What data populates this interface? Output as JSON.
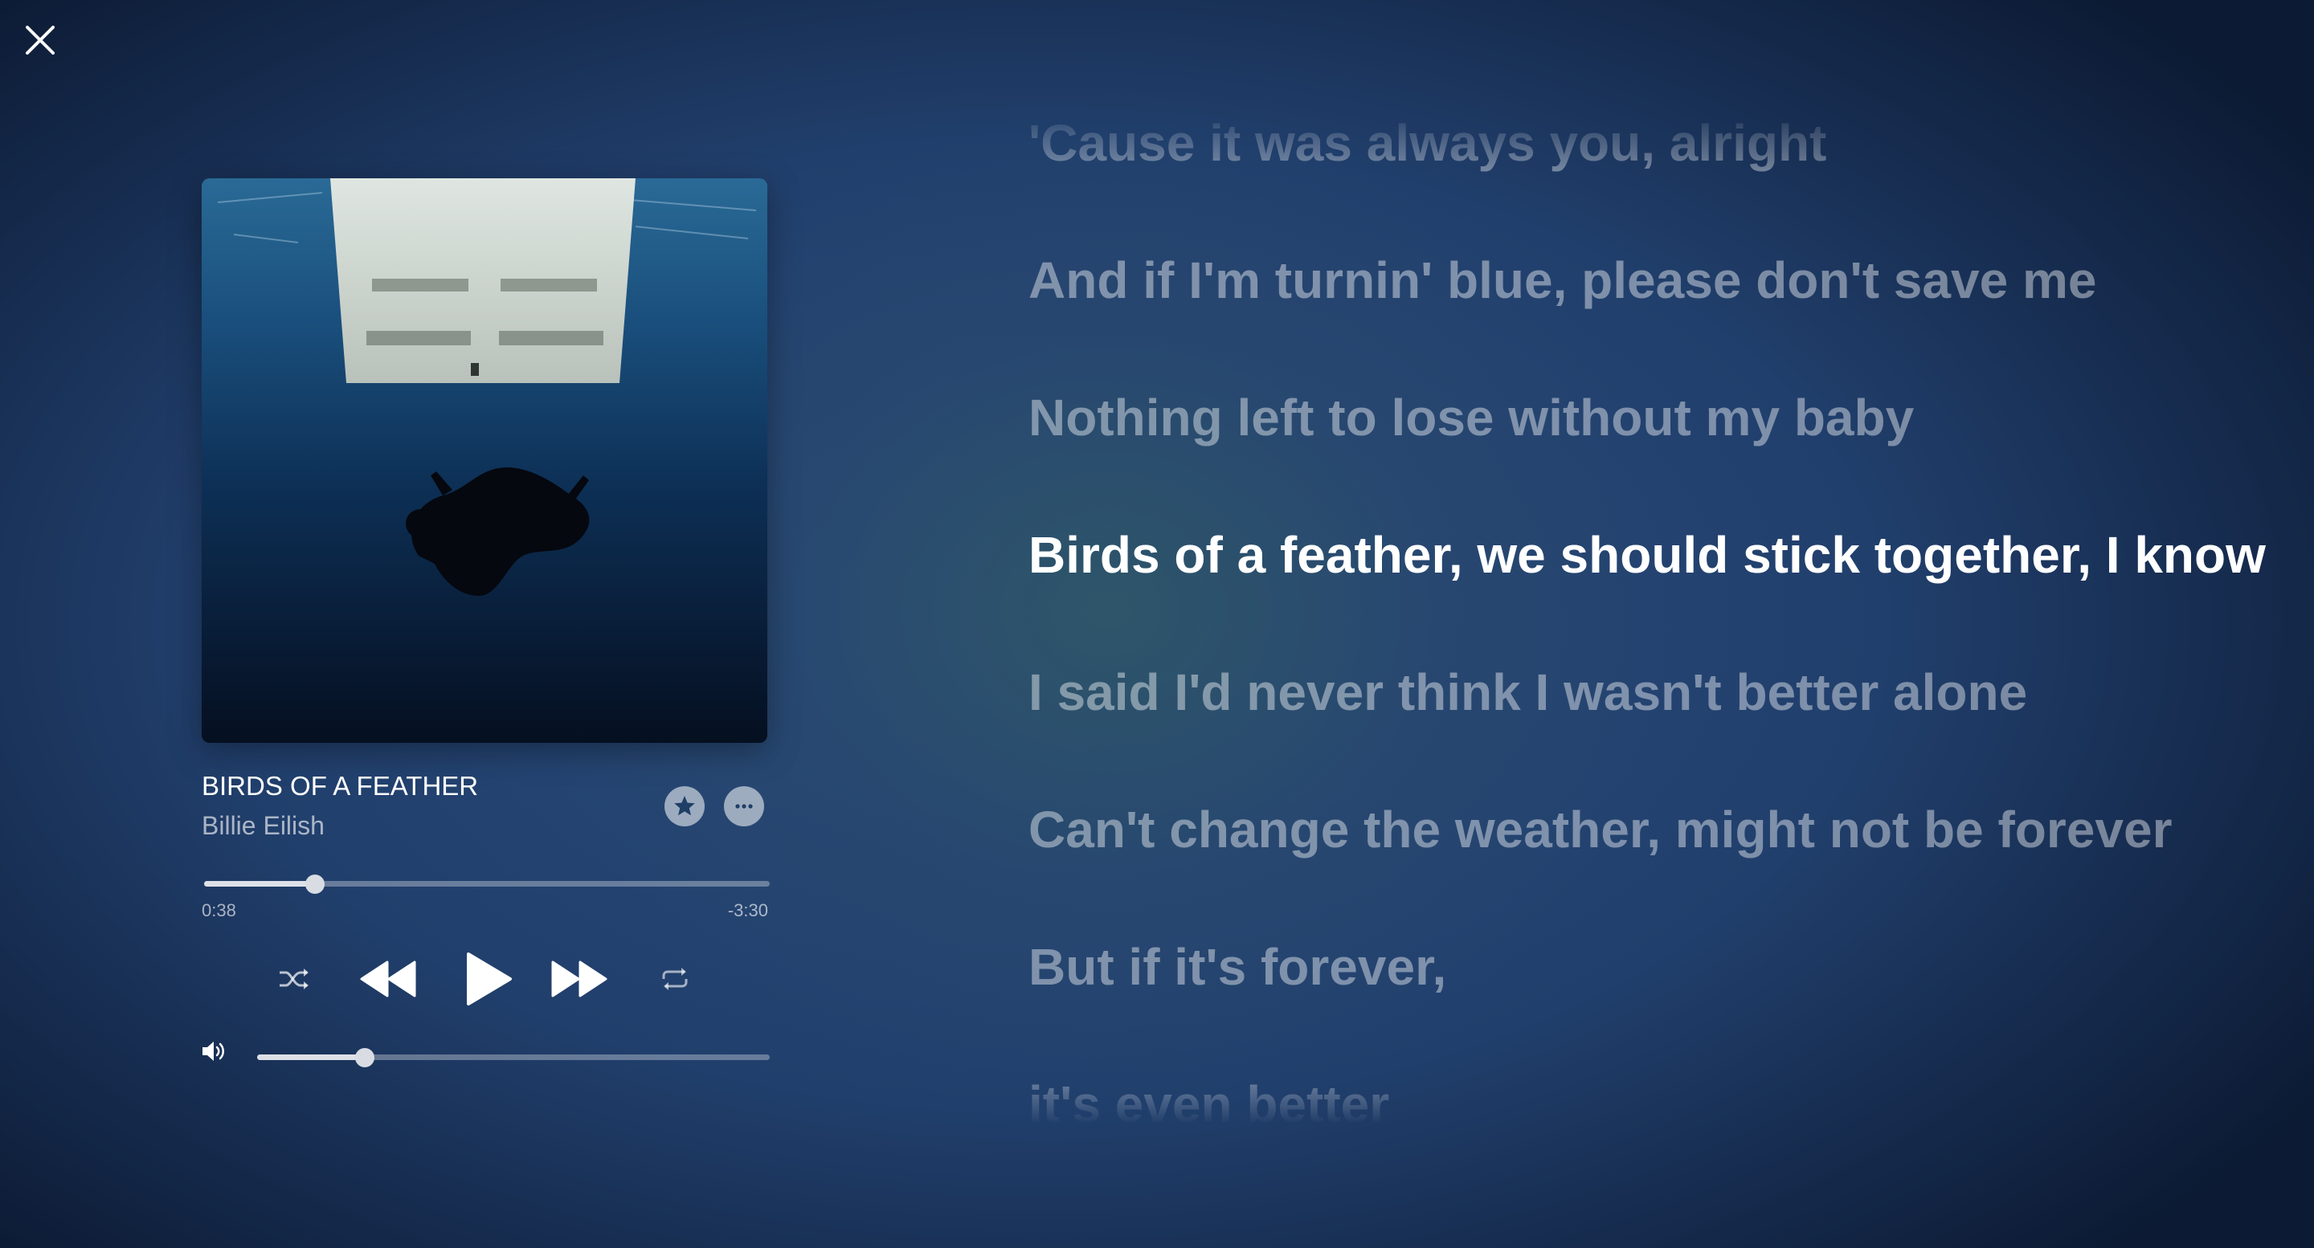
{
  "window": {
    "close_icon": "close-icon"
  },
  "album": {
    "art_icon": "album-art-underwater"
  },
  "track": {
    "title": "BIRDS OF A FEATHER",
    "artist": "Billie Eilish",
    "favorite_icon": "star-icon",
    "more_icon": "ellipsis-icon"
  },
  "progress": {
    "elapsed": "0:38",
    "remaining": "-3:30",
    "fraction": 0.196
  },
  "controls": {
    "shuffle_icon": "shuffle-icon",
    "rewind_icon": "rewind-icon",
    "play_icon": "play-icon",
    "forward_icon": "fast-forward-icon",
    "repeat_icon": "repeat-icon"
  },
  "volume": {
    "icon": "speaker-icon",
    "fraction": 0.21
  },
  "lyrics": {
    "lines": [
      {
        "text": "'Cause it was always you, alright",
        "current": false
      },
      {
        "text": "And if I'm turnin' blue, please don't save me",
        "current": false
      },
      {
        "text": "Nothing left to lose without my baby",
        "current": false
      },
      {
        "text": "Birds of a feather, we should stick together, I know",
        "current": true
      },
      {
        "text": "I said I'd never think I wasn't better alone",
        "current": false
      },
      {
        "text": "Can't change the weather, might not be forever",
        "current": false
      },
      {
        "text": "But if it's forever,",
        "current": false
      },
      {
        "text": "it's even better",
        "current": false
      }
    ]
  },
  "colors": {
    "background": "#213f6c",
    "current_lyric": "#ffffff",
    "inactive_lyric": "#8a9bb0"
  }
}
